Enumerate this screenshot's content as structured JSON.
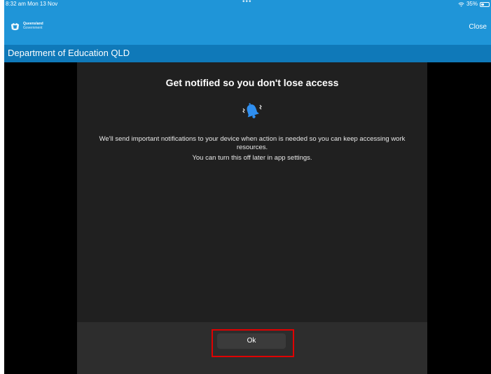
{
  "status_bar": {
    "time_date": "8:32 am  Mon 13 Nov",
    "multitask_dots": "•••",
    "battery_percent": "35%",
    "battery_level": 0.35,
    "wifi_icon": "wifi-icon"
  },
  "header": {
    "logo_text_line1": "Queensland",
    "logo_text_line2": "Government",
    "close_label": "Close",
    "color_top": "#1f95d8",
    "color_nav": "#0f79b9"
  },
  "nav": {
    "title": "Department of Education QLD"
  },
  "dialog": {
    "title": "Get notified so you don't lose access",
    "icon": "bell-icon",
    "icon_color": "#2f8ff0",
    "body_line1": "We'll send important notifications to your device when action is needed so you can keep accessing work resources.",
    "body_line2": "You can turn this off later in app settings.",
    "ok_label": "Ok",
    "highlight_color": "#e00000"
  }
}
